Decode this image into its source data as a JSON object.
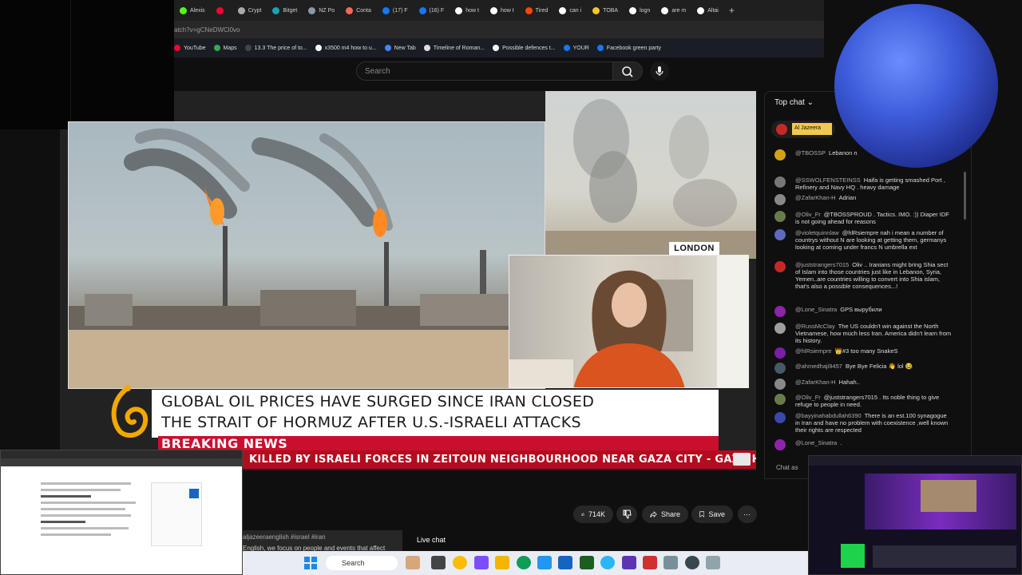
{
  "browser": {
    "tabs": [
      {
        "label": "Alexis",
        "icon": "kick-icon",
        "color": "#53fc18"
      },
      {
        "label": "",
        "icon": "youtube-icon",
        "color": "#ff0033"
      },
      {
        "label": "Crypt",
        "icon": "crypto-icon",
        "color": "#aaaaaa"
      },
      {
        "label": "Bitget",
        "icon": "bitget-icon",
        "color": "#1da2b4"
      },
      {
        "label": "NZ Po",
        "icon": "globe-icon",
        "color": "#8899aa"
      },
      {
        "label": "Conta",
        "icon": "patreon-icon",
        "color": "#f96854"
      },
      {
        "label": "(17) F",
        "icon": "facebook-icon",
        "color": "#1877f2"
      },
      {
        "label": "(16) F",
        "icon": "facebook-icon",
        "color": "#1877f2"
      },
      {
        "label": "how t",
        "icon": "google-icon",
        "color": "#ffffff"
      },
      {
        "label": "how t",
        "icon": "google-icon",
        "color": "#ffffff"
      },
      {
        "label": "Tired",
        "icon": "reddit-icon",
        "color": "#ff4500"
      },
      {
        "label": "can i",
        "icon": "google-icon",
        "color": "#ffffff"
      },
      {
        "label": "TOBA",
        "icon": "bookmark-icon",
        "color": "#f4c430"
      },
      {
        "label": "logn",
        "icon": "google-icon",
        "color": "#ffffff"
      },
      {
        "label": "are m",
        "icon": "google-icon",
        "color": "#ffffff"
      },
      {
        "label": "Altai",
        "icon": "google-icon",
        "color": "#ffffff"
      }
    ],
    "new_tab": "+",
    "url": "atch?v=gCNeDWCl0vo",
    "bookmarks": [
      {
        "label": "YouTube",
        "color": "#ff0033"
      },
      {
        "label": "Maps",
        "color": "#34a853"
      },
      {
        "label": "13.3 The price of to...",
        "color": "#444444"
      },
      {
        "label": "x3500 m4 how to u...",
        "color": "#ffffff"
      },
      {
        "label": "New Tab",
        "color": "#4285f4"
      },
      {
        "label": "Timeline of Roman...",
        "color": "#dddddd"
      },
      {
        "label": "Possible defences t...",
        "color": "#ffffff"
      },
      {
        "label": "YOUR",
        "color": "#1877f2"
      },
      {
        "label": "Facebook green party",
        "color": "#1877f2"
      }
    ]
  },
  "youtube": {
    "search_placeholder": "Search",
    "video": {
      "location_label": "LONDON",
      "headline_line1": "GLOBAL OIL PRICES HAVE SURGED SINCE IRAN CLOSED",
      "headline_line2": "THE STRAIT OF HORMUZ AFTER U.S.-ISRAELI ATTACKS",
      "breaking": "BREAKING NEWS",
      "ticker": "KILLED BY ISRAELI FORCES IN ZEITOUN NEIGHBOURHOOD NEAR GAZA CITY   -   GAZA HEAL"
    },
    "actions": {
      "likes": "714K",
      "share": "Share",
      "save": "Save",
      "more": "⋯"
    },
    "description_snippet": "aljazeeraenglish #israel #iran",
    "description_snippet2": "English, we focus on people and events that affect",
    "live_chat_label": "Live chat"
  },
  "chat": {
    "header": "Top chat",
    "pinned_label": "Al Jazeera",
    "input_placeholder": "Chat as",
    "messages": [
      {
        "author": "@TBOSSP",
        "text": "Lebanon n",
        "color": "#d4a017"
      },
      {
        "author": "@SSWOLFENSTEINSS",
        "text": "Haifa is getting smashed Port , Refinery and Navy HQ . heavy damage",
        "color": "#777777"
      },
      {
        "author": "@ZafarKhan-H",
        "text": "Adrian",
        "color": "#888888"
      },
      {
        "author": "@Oliv_Fr",
        "text": "@TBOSSPROUD . Tactics. IMO. :)) Diaper IDF is not going ahead for reasons",
        "color": "#6a7b4a"
      },
      {
        "author": "@violetquinnlaw",
        "text": "@hlRsiempre nah i mean a number of countrys without N are looking at getting them, germanys looking at coming under francs N umbrella ext",
        "color": "#5c6bc0"
      },
      {
        "author": "@juststrangers7015",
        "text": "Oliv .. Iranians might bring Shia sect of Islam into those countries just like in Lebanon, Syria, Yemen..are countries willing to convert into Shia islam, that's also a possible consequences...!",
        "color": "#c62828"
      },
      {
        "author": "@Lone_Sinatra",
        "text": "GPS вырубили",
        "color": "#8e24aa"
      },
      {
        "author": "@RussMcClay",
        "text": "The US couldn't win against the North Vietnamese, how much less Iran. America didn't learn from its history.",
        "color": "#9e9e9e"
      },
      {
        "author": "@hlRsiempre",
        "text": "👑#3  too many SnakeS",
        "color": "#7b1fa2"
      },
      {
        "author": "@ahmedhaji9457",
        "text": "Bye Bye Felicia 👋 lol 😂",
        "color": "#455a64"
      },
      {
        "author": "@ZafarKhan-H",
        "text": "Hahah..",
        "color": "#888888"
      },
      {
        "author": "@Oliv_Fr",
        "text": "@juststrangers7015 . Its noble thing to give refuge to people in need.",
        "color": "#6a7b4a"
      },
      {
        "author": "@bayyinahabdullah6390",
        "text": "There is an est.100 synagogue in Iran and have no problem with coexistence ,well known their rights are respected",
        "color": "#3949ab"
      },
      {
        "author": "@Lone_Sinatra",
        "text": ".",
        "color": "#8e24aa"
      }
    ]
  },
  "taskbar": {
    "search_label": "Search"
  },
  "colors": {
    "breaking_red": "#c8102e",
    "ticker_red": "#b30c1f",
    "aj_gold": "#f2a900"
  }
}
